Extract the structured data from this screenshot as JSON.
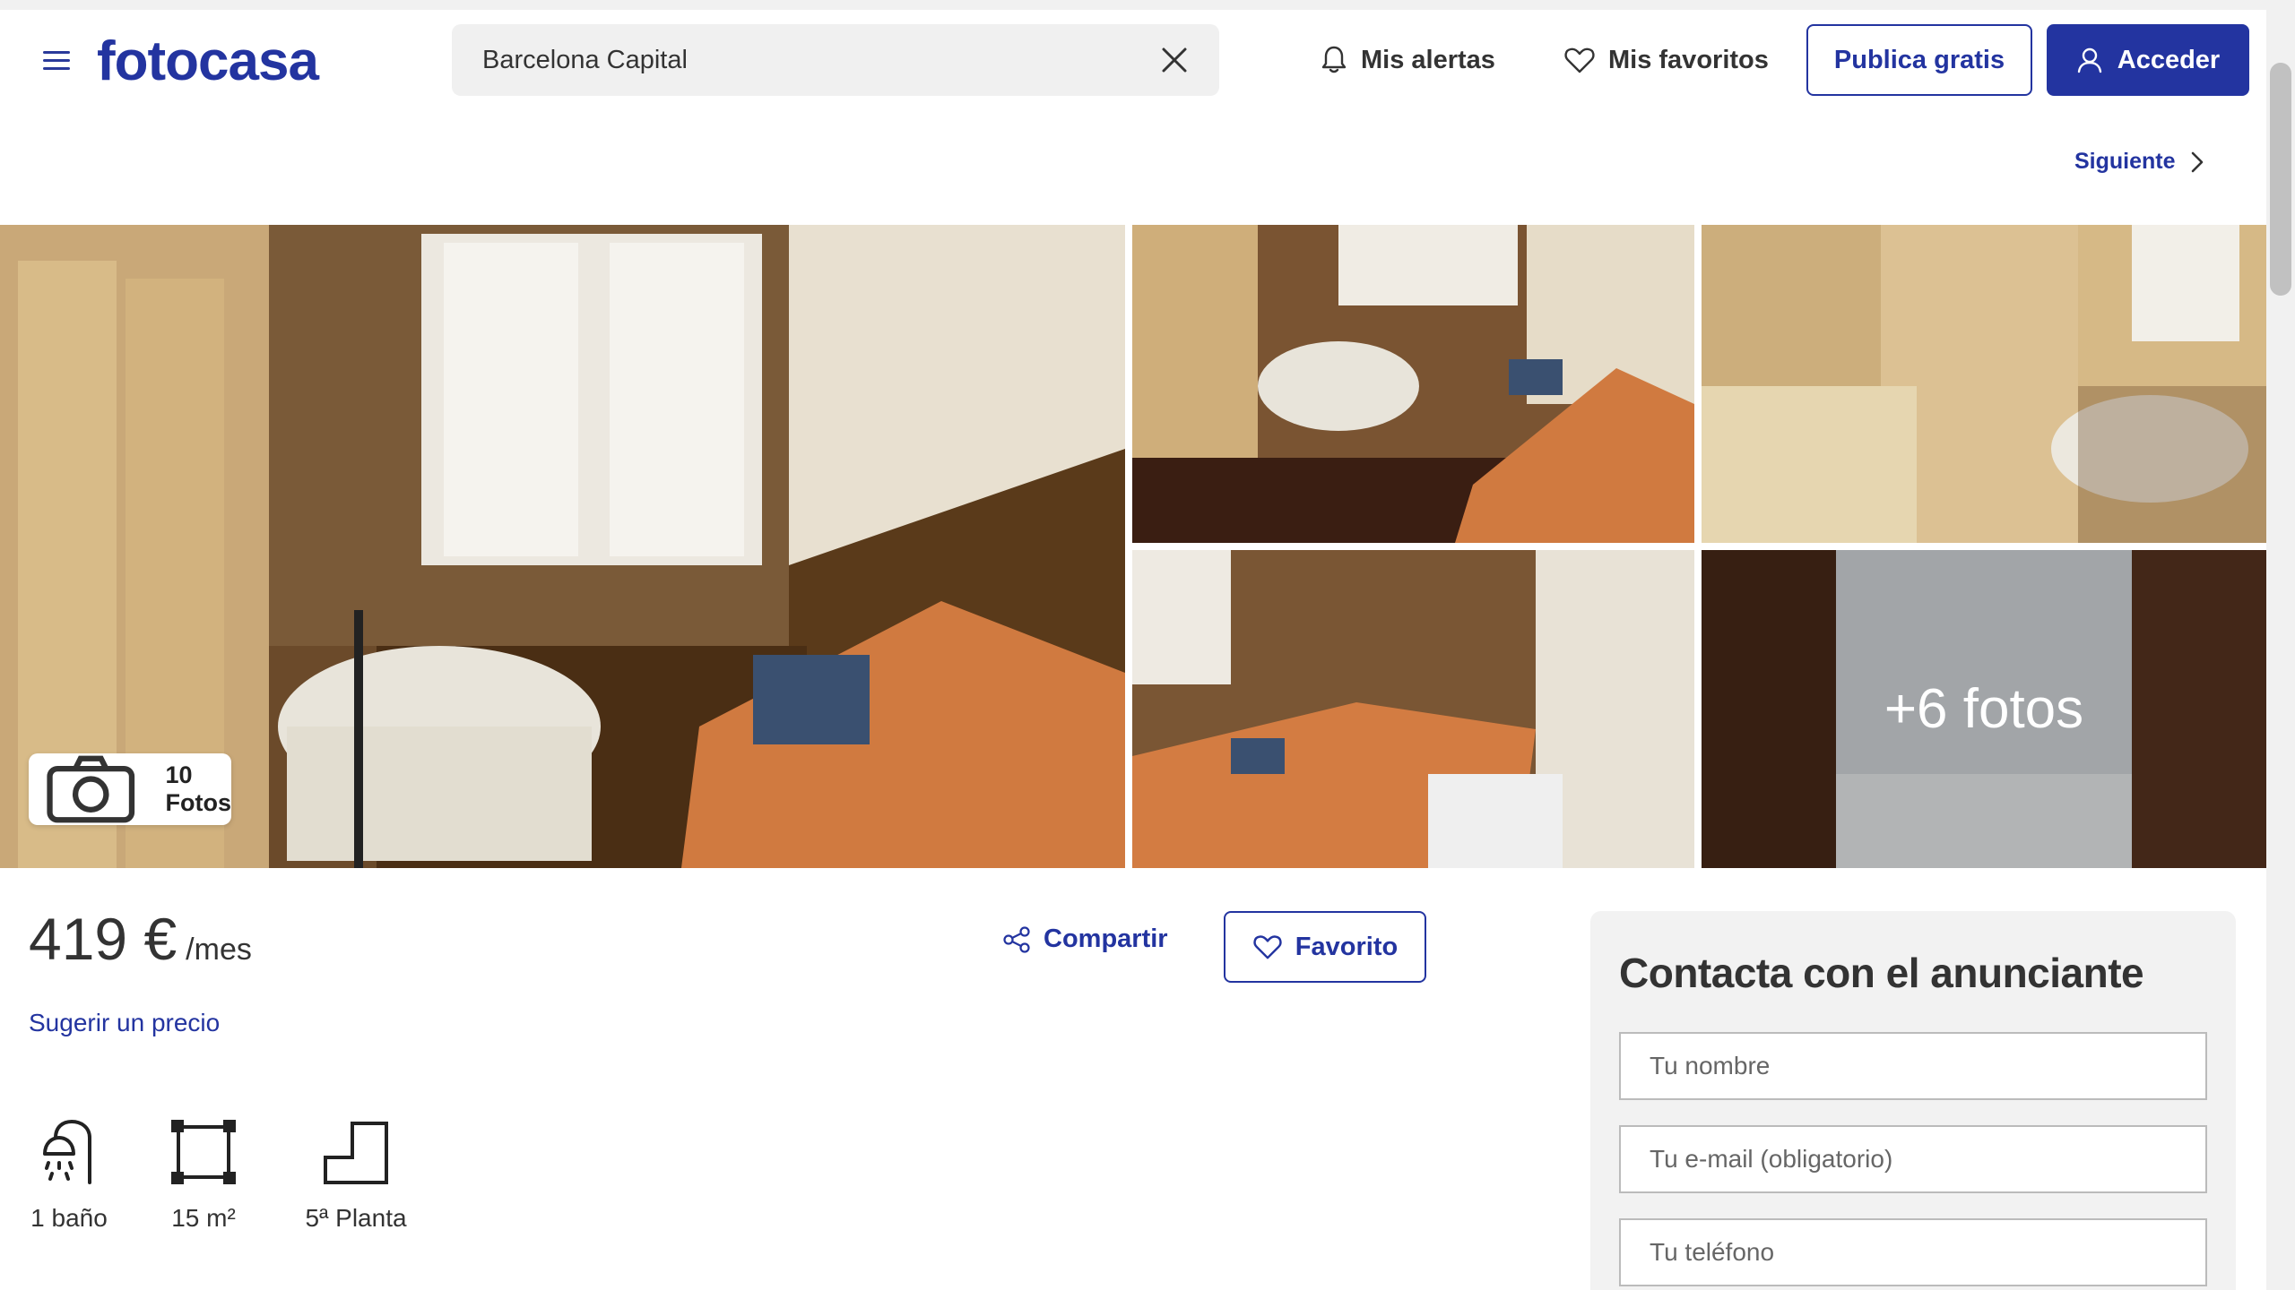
{
  "header": {
    "logo": "fotocasa",
    "search": {
      "value": "Barcelona Capital",
      "placeholder": ""
    },
    "alerts_label": "Mis alertas",
    "favorites_label": "Mis favoritos",
    "publish_label": "Publica gratis",
    "login_label": "Acceder"
  },
  "navigation": {
    "next_label": "Siguiente"
  },
  "gallery": {
    "photos_button_label": "10 Fotos",
    "more_photos_label": "+6 fotos"
  },
  "listing": {
    "price_value": "419 €",
    "price_unit": "/mes",
    "suggest_price_label": "Sugerir un precio",
    "share_label": "Compartir",
    "favorite_label": "Favorito",
    "features": [
      {
        "icon": "shower-icon",
        "label": "1 baño"
      },
      {
        "icon": "area-icon",
        "label": "15 m²"
      },
      {
        "icon": "stairs-icon",
        "label": "5ª Planta"
      }
    ]
  },
  "contact": {
    "title": "Contacta con el anunciante",
    "name_placeholder": "Tu nombre",
    "email_placeholder": "Tu e-mail (obligatorio)",
    "phone_placeholder": "Tu teléfono"
  },
  "colors": {
    "brand": "#2334a0",
    "text": "#333333",
    "panel_bg": "#f2f2f2"
  }
}
